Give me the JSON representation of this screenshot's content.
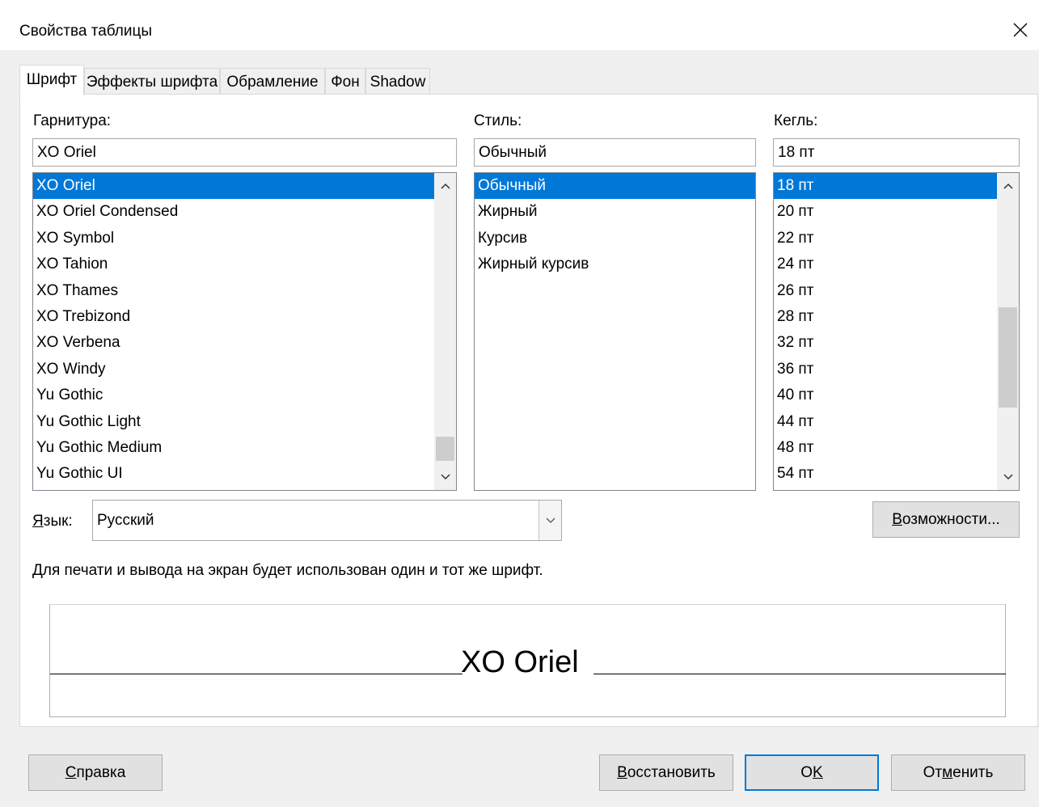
{
  "window": {
    "title": "Свойства таблицы"
  },
  "tabs": [
    {
      "label": "Шрифт",
      "active": true
    },
    {
      "label": "Эффекты шрифта",
      "active": false
    },
    {
      "label": "Обрамление",
      "active": false
    },
    {
      "label": "Фон",
      "active": false
    },
    {
      "label": "Shadow",
      "active": false
    }
  ],
  "family": {
    "label": "Гарнитура:",
    "value": "XO Oriel",
    "items": [
      "XO Oriel",
      "XO Oriel Condensed",
      "XO Symbol",
      "XO Tahion",
      "XO Thames",
      "XO Trebizond",
      "XO Verbena",
      "XO Windy",
      "Yu Gothic",
      "Yu Gothic Light",
      "Yu Gothic Medium",
      "Yu Gothic UI"
    ],
    "selected_index": 0
  },
  "style": {
    "label": "Стиль:",
    "value": "Обычный",
    "items": [
      "Обычный",
      "Жирный",
      "Курсив",
      "Жирный курсив"
    ],
    "selected_index": 0
  },
  "size": {
    "label": "Кегль:",
    "value": "18 пт",
    "items": [
      "18 пт",
      "20 пт",
      "22 пт",
      "24 пт",
      "26 пт",
      "28 пт",
      "32 пт",
      "36 пт",
      "40 пт",
      "44 пт",
      "48 пт",
      "54 пт"
    ],
    "selected_index": 0
  },
  "language": {
    "label_accel": "Я",
    "label_rest": "зык:",
    "value": "Русский"
  },
  "features_button": {
    "accel": "В",
    "rest": "озможности..."
  },
  "info_text": "Для печати и вывода на экран будет использован один и тот же шрифт.",
  "preview": {
    "text": "XO Oriel"
  },
  "buttons": {
    "help": {
      "accel": "С",
      "rest": "правка"
    },
    "reset": {
      "accel": "В",
      "rest": "осстановить"
    },
    "ok": {
      "pre": "O",
      "accel": "K",
      "rest": ""
    },
    "cancel": {
      "pre": "От",
      "accel": "м",
      "rest": "енить"
    }
  },
  "colors": {
    "accent": "#0078d7",
    "panel": "#ffffff",
    "dialog_bg": "#f0f0f0"
  },
  "icons": {
    "close": "close-icon",
    "scroll_up": "chevron-up-icon",
    "scroll_down": "chevron-down-icon",
    "combo": "chevron-down-icon"
  }
}
